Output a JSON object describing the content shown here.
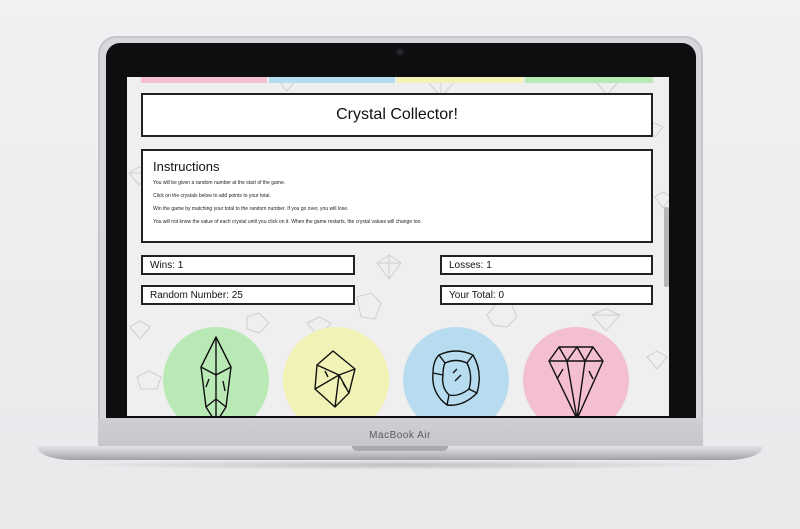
{
  "device": {
    "brand": "MacBook Air"
  },
  "game": {
    "title": "Crystal Collector!",
    "instructions": {
      "heading": "Instructions",
      "lines": [
        "You will be given a random number at the start of the game.",
        "Click on the crystals below to add points to your total.",
        "Win the game by matching your total to the random number. If you go over, you will lose.",
        "You will not know the value of each crystal until you click on it. When the game restarts, the crystal values will change too."
      ]
    },
    "stats": {
      "wins": "Wins: 1",
      "losses": "Losses: 1",
      "random_number": "Random Number: 25",
      "your_total": "Your Total: 0"
    },
    "crystals": [
      {
        "icon": "crystal-prism-icon",
        "color": "#b9eab5"
      },
      {
        "icon": "crystal-octahedron-icon",
        "color": "#f1f3b6"
      },
      {
        "icon": "crystal-cushion-icon",
        "color": "#b7dcef"
      },
      {
        "icon": "crystal-gem-icon",
        "color": "#f4bfce"
      }
    ],
    "top_strip_colors": [
      "#f4bfce",
      "#b7dcef",
      "#f1f3b6",
      "#b9eab5"
    ]
  }
}
